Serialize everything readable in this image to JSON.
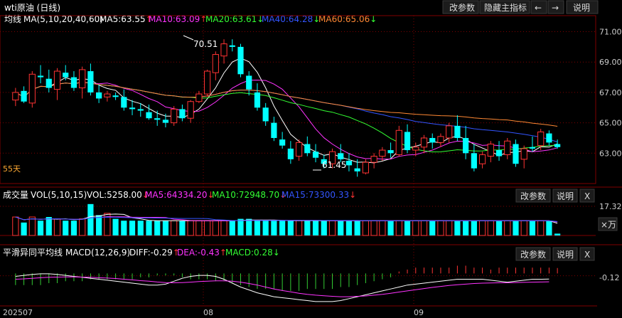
{
  "window": {
    "title": "wti原油 (日线)",
    "buttons": [
      "改参数",
      "隐藏主指标",
      "←",
      "→",
      "说明"
    ]
  },
  "main_panel": {
    "indicator_name": "均线",
    "params": "MA(5,10,20,40,60)",
    "ma_legend": [
      {
        "label": "MA5:63.55",
        "arrow": "↑",
        "color": "#ffffff"
      },
      {
        "label": "MA10:63.09",
        "arrow": "↑",
        "color": "#ff33ff"
      },
      {
        "label": "MA20:63.61",
        "arrow": "↓",
        "color": "#33ff33"
      },
      {
        "label": "MA40:64.28",
        "arrow": "↓",
        "color": "#3355ff"
      },
      {
        "label": "MA60:65.06",
        "arrow": "↓",
        "color": "#ff8833"
      }
    ],
    "y_ticks": [
      "71.00",
      "69.00",
      "67.00",
      "65.00",
      "63.00"
    ],
    "annotations": {
      "high": "70.51",
      "low": "61.45",
      "days": "55天"
    }
  },
  "volume_panel": {
    "name": "成交量",
    "params": "VOL(5,10,15)",
    "values": [
      {
        "label": "VOL:5258.00",
        "arrow": "↓",
        "color": "#ffffff"
      },
      {
        "label": "MA5:64334.20",
        "arrow": "↓",
        "color": "#ff33ff"
      },
      {
        "label": "MA10:72948.70",
        "arrow": "↓",
        "color": "#33ff33"
      },
      {
        "label": "MA15:73300.33",
        "arrow": "↓",
        "color": "#3355ff"
      }
    ],
    "buttons": [
      "改参数",
      "说明",
      "X"
    ],
    "y_tick": "17.32",
    "unit": "×万"
  },
  "macd_panel": {
    "name": "平滑异同平均线",
    "params": "MACD(12,26,9)",
    "values": [
      {
        "label": "DIFF:-0.29",
        "arrow": "↑",
        "color": "#ffffff"
      },
      {
        "label": "DEA:-0.43",
        "arrow": "↑",
        "color": "#ff33ff"
      },
      {
        "label": "MACD:0.28",
        "arrow": "↓",
        "color": "#33ff33"
      }
    ],
    "buttons": [
      "改参数",
      "说明",
      "X"
    ],
    "y_tick": "-0.12"
  },
  "x_axis": {
    "labels": [
      "202507",
      "08",
      "09"
    ]
  },
  "colors": {
    "up": "#ff3333",
    "down": "#00ffff",
    "grid": "#800000",
    "bg": "#000000"
  },
  "chart_data": {
    "type": "candlestick",
    "ylim": [
      61.0,
      71.4
    ],
    "candles": [
      [
        66.5,
        67.3,
        66.1,
        67.0
      ],
      [
        67.1,
        67.4,
        66.3,
        66.4
      ],
      [
        66.3,
        68.4,
        66.0,
        68.2
      ],
      [
        68.1,
        68.8,
        67.6,
        68.0
      ],
      [
        67.9,
        68.5,
        67.0,
        67.3
      ],
      [
        67.2,
        68.6,
        66.5,
        68.4
      ],
      [
        68.3,
        68.8,
        67.8,
        68.0
      ],
      [
        68.0,
        68.4,
        67.1,
        67.3
      ],
      [
        67.3,
        68.7,
        66.6,
        68.5
      ],
      [
        68.4,
        68.9,
        66.8,
        67.0
      ],
      [
        67.0,
        67.5,
        66.3,
        66.6
      ],
      [
        66.7,
        67.1,
        66.4,
        66.9
      ],
      [
        66.8,
        67.0,
        66.5,
        66.7
      ],
      [
        66.7,
        67.2,
        65.8,
        66.0
      ],
      [
        66.0,
        66.5,
        65.5,
        65.9
      ],
      [
        65.9,
        66.3,
        65.4,
        65.8
      ],
      [
        65.7,
        66.2,
        65.2,
        65.3
      ],
      [
        65.3,
        65.8,
        64.8,
        65.2
      ],
      [
        65.2,
        65.6,
        64.7,
        65.0
      ],
      [
        65.0,
        66.1,
        64.8,
        65.9
      ],
      [
        65.9,
        66.2,
        65.1,
        65.3
      ],
      [
        65.3,
        66.5,
        65.0,
        66.4
      ],
      [
        66.4,
        67.1,
        66.3,
        66.9
      ],
      [
        66.9,
        68.5,
        66.7,
        68.4
      ],
      [
        68.3,
        69.7,
        67.8,
        69.5
      ],
      [
        69.4,
        70.5,
        68.9,
        70.2
      ],
      [
        70.1,
        70.5,
        69.7,
        70.0
      ],
      [
        70.0,
        70.2,
        68.0,
        68.2
      ],
      [
        68.1,
        68.4,
        66.8,
        67.2
      ],
      [
        67.0,
        67.6,
        65.8,
        66.0
      ],
      [
        66.0,
        66.3,
        64.8,
        65.1
      ],
      [
        65.0,
        65.4,
        63.8,
        64.0
      ],
      [
        63.9,
        64.4,
        63.3,
        63.5
      ],
      [
        63.3,
        63.8,
        62.3,
        62.6
      ],
      [
        62.8,
        63.9,
        62.5,
        63.7
      ],
      [
        63.6,
        64.1,
        62.8,
        63.0
      ],
      [
        63.1,
        63.6,
        62.4,
        62.7
      ],
      [
        62.6,
        62.9,
        62.0,
        62.3
      ],
      [
        62.3,
        63.3,
        62.0,
        63.1
      ],
      [
        63.0,
        63.6,
        62.4,
        62.6
      ],
      [
        62.5,
        63.0,
        61.8,
        62.2
      ],
      [
        62.0,
        62.6,
        61.45,
        61.8
      ],
      [
        61.7,
        62.6,
        61.6,
        62.4
      ],
      [
        62.4,
        63.0,
        62.0,
        62.8
      ],
      [
        62.8,
        63.4,
        62.5,
        63.2
      ],
      [
        63.2,
        63.7,
        62.7,
        63.0
      ],
      [
        62.9,
        64.8,
        62.8,
        64.5
      ],
      [
        64.4,
        64.9,
        63.0,
        63.2
      ],
      [
        63.2,
        63.7,
        62.8,
        63.4
      ],
      [
        63.4,
        64.2,
        63.0,
        64.0
      ],
      [
        64.0,
        64.3,
        63.3,
        63.7
      ],
      [
        63.7,
        64.3,
        63.4,
        64.1
      ],
      [
        64.0,
        65.0,
        63.7,
        64.8
      ],
      [
        64.8,
        65.5,
        63.8,
        64.0
      ],
      [
        64.0,
        64.8,
        62.6,
        63.0
      ],
      [
        63.0,
        63.6,
        61.8,
        62.0
      ],
      [
        62.3,
        63.1,
        62.0,
        62.9
      ],
      [
        62.8,
        63.8,
        62.4,
        63.6
      ],
      [
        63.2,
        63.8,
        62.5,
        62.8
      ],
      [
        62.9,
        64.0,
        62.6,
        63.8
      ],
      [
        63.6,
        63.9,
        62.1,
        62.3
      ],
      [
        62.6,
        63.5,
        62.0,
        63.3
      ],
      [
        63.4,
        64.1,
        63.1,
        63.3
      ],
      [
        63.5,
        64.6,
        63.2,
        64.4
      ],
      [
        64.3,
        64.5,
        63.5,
        63.7
      ],
      [
        63.6,
        63.9,
        63.3,
        63.4
      ]
    ],
    "volume": [
      10,
      7,
      10,
      8,
      10,
      9,
      8,
      8,
      9,
      17,
      11,
      12,
      9,
      8,
      8,
      8,
      8,
      8,
      8,
      8,
      8,
      8,
      8,
      8,
      8,
      8,
      8,
      9,
      9,
      8,
      8,
      8,
      8,
      8,
      8,
      8,
      8,
      8,
      8,
      8,
      8,
      8,
      8,
      8,
      8,
      8,
      8,
      8,
      8,
      8,
      8,
      8,
      8,
      8,
      8,
      8,
      8,
      8,
      8,
      8,
      8,
      8,
      8,
      8,
      8,
      1
    ],
    "macd": [
      -0.6,
      -0.6,
      -0.6,
      -0.6,
      -0.5,
      -0.5,
      -0.4,
      -0.4,
      -0.4,
      -0.3,
      -0.3,
      -0.3,
      -0.3,
      -0.3,
      -0.3,
      -0.2,
      -0.2,
      -0.1,
      -0.1,
      -0.1,
      -0.2,
      -0.3,
      -0.3,
      -0.3,
      -0.4,
      -0.4,
      -0.5,
      -0.6,
      -0.7,
      -0.8,
      -0.8,
      -0.8,
      -0.9,
      -0.9,
      -0.9,
      -0.8,
      -0.8,
      -0.8,
      -0.8,
      -0.7,
      -0.7,
      -0.6,
      -0.5,
      -0.4,
      -0.3,
      -0.2,
      0.1,
      0.2,
      0.3,
      0.3,
      0.3,
      0.3,
      0.3,
      0.4,
      0.4,
      0.3,
      0.3,
      0.2,
      0.3,
      0.3,
      0.3,
      0.3,
      0.3,
      0.3,
      0.3,
      0.28
    ],
    "diff": [
      -0.15,
      -0.1,
      -0.05,
      -0.02,
      -0.02,
      -0.05,
      -0.1,
      -0.15,
      -0.2,
      -0.25,
      -0.3,
      -0.35,
      -0.4,
      -0.45,
      -0.5,
      -0.55,
      -0.6,
      -0.6,
      -0.55,
      -0.4,
      -0.25,
      -0.15,
      -0.1,
      -0.1,
      -0.15,
      -0.3,
      -0.5,
      -0.7,
      -0.85,
      -1.0,
      -1.1,
      -1.2,
      -1.25,
      -1.3,
      -1.35,
      -1.4,
      -1.45,
      -1.45,
      -1.45,
      -1.4,
      -1.3,
      -1.2,
      -1.1,
      -1.0,
      -0.9,
      -0.8,
      -0.7,
      -0.6,
      -0.55,
      -0.5,
      -0.45,
      -0.4,
      -0.35,
      -0.3,
      -0.3,
      -0.3,
      -0.3,
      -0.35,
      -0.4,
      -0.45,
      -0.4,
      -0.35,
      -0.3,
      -0.3,
      -0.29
    ],
    "dea": [
      -0.3,
      -0.28,
      -0.25,
      -0.22,
      -0.2,
      -0.19,
      -0.18,
      -0.18,
      -0.19,
      -0.2,
      -0.22,
      -0.24,
      -0.26,
      -0.3,
      -0.33,
      -0.37,
      -0.4,
      -0.44,
      -0.47,
      -0.48,
      -0.47,
      -0.45,
      -0.42,
      -0.4,
      -0.38,
      -0.38,
      -0.4,
      -0.45,
      -0.52,
      -0.6,
      -0.7,
      -0.8,
      -0.88,
      -0.95,
      -1.02,
      -1.08,
      -1.12,
      -1.15,
      -1.18,
      -1.2,
      -1.2,
      -1.18,
      -1.16,
      -1.12,
      -1.08,
      -1.02,
      -0.96,
      -0.9,
      -0.84,
      -0.78,
      -0.72,
      -0.67,
      -0.62,
      -0.58,
      -0.55,
      -0.52,
      -0.5,
      -0.49,
      -0.48,
      -0.48,
      -0.47,
      -0.46,
      -0.45,
      -0.44,
      -0.43
    ]
  }
}
